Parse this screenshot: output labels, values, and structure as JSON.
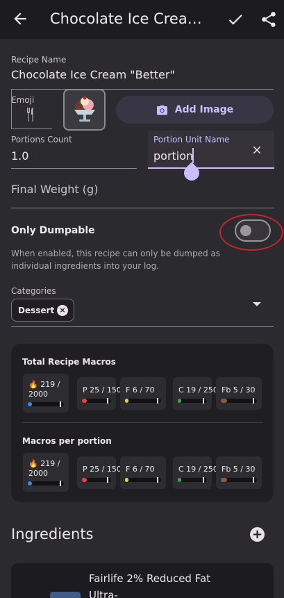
{
  "appbar": {
    "title": "Chocolate Ice Cream ...",
    "back_icon": "arrow-back-icon",
    "save_icon": "check-icon",
    "share_icon": "share-icon"
  },
  "recipe_name": {
    "label": "Recipe Name",
    "value": "Chocolate Ice Cream \"Better\""
  },
  "emoji": {
    "label": "Emoji",
    "placeholder_icon": "fork-knife-icon",
    "selected": "🍨"
  },
  "add_image": {
    "label": "Add Image",
    "icon": "camera-icon"
  },
  "portions_count": {
    "label": "Portions Count",
    "value": "1.0"
  },
  "portion_unit": {
    "label": "Portion Unit Name",
    "value": "portion",
    "clear_icon": "close-icon"
  },
  "final_weight": {
    "placeholder": "Final Weight (g)"
  },
  "only_dumpable": {
    "title": "Only Dumpable",
    "help": "When enabled, this recipe can only be dumped as individual ingredients into your log.",
    "enabled": false
  },
  "categories": {
    "label": "Categories",
    "chips": [
      "Dessert"
    ]
  },
  "macros": {
    "total_heading": "Total Recipe Macros",
    "per_portion_heading": "Macros per portion",
    "calories_icon": "🔥",
    "total": [
      {
        "line1": "219 /",
        "line2": "2000",
        "fraction": 0.11,
        "color": "#2f8fe8"
      },
      {
        "line1": "P 25 / 150",
        "fraction": 0.17,
        "color": "#e84343"
      },
      {
        "line1": "F 6 / 70",
        "fraction": 0.09,
        "color": "#e8d23a"
      },
      {
        "line1": "C 19 / 250",
        "fraction": 0.08,
        "color": "#3fa552"
      },
      {
        "line1": "Fb 5 / 30",
        "fraction": 0.17,
        "color": "#8a5a3f"
      }
    ],
    "per_portion": [
      {
        "line1": "219 /",
        "line2": "2000",
        "fraction": 0.11,
        "color": "#2f8fe8"
      },
      {
        "line1": "P 25 / 150",
        "fraction": 0.17,
        "color": "#e84343"
      },
      {
        "line1": "F 6 / 70",
        "fraction": 0.09,
        "color": "#e8d23a"
      },
      {
        "line1": "C 19 / 250",
        "fraction": 0.08,
        "color": "#3fa552"
      },
      {
        "line1": "Fb 5 / 30",
        "fraction": 0.17,
        "color": "#8a5a3f"
      }
    ]
  },
  "ingredients": {
    "title": "Ingredients",
    "add_icon": "add-circle-icon",
    "items": [
      {
        "name": "Fairlife 2% Reduced Fat Ultra-"
      }
    ]
  }
}
